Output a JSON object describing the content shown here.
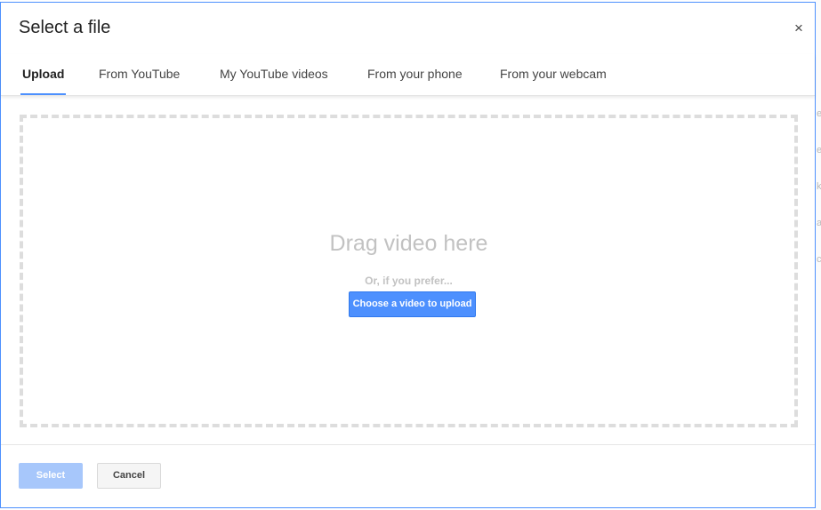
{
  "dialog": {
    "title": "Select a file",
    "close_glyph": "×",
    "close_icon": "close-icon"
  },
  "tabs": [
    {
      "label": "Upload",
      "active": true
    },
    {
      "label": "From YouTube",
      "active": false
    },
    {
      "label": "My YouTube videos",
      "active": false
    },
    {
      "label": "From your phone",
      "active": false
    },
    {
      "label": "From your webcam",
      "active": false
    }
  ],
  "dropzone": {
    "title": "Drag video here",
    "subtitle": "Or, if you prefer...",
    "choose_label": "Choose a video to upload"
  },
  "footer": {
    "select_label": "Select",
    "cancel_label": "Cancel"
  },
  "colors": {
    "accent": "#4d90fe",
    "accent_disabled": "#a7c7fb",
    "dashed_border": "#dddddd",
    "muted_text": "#c2c2c2"
  },
  "background_fragments": [
    "e",
    "e",
    "k",
    "a",
    "c"
  ]
}
